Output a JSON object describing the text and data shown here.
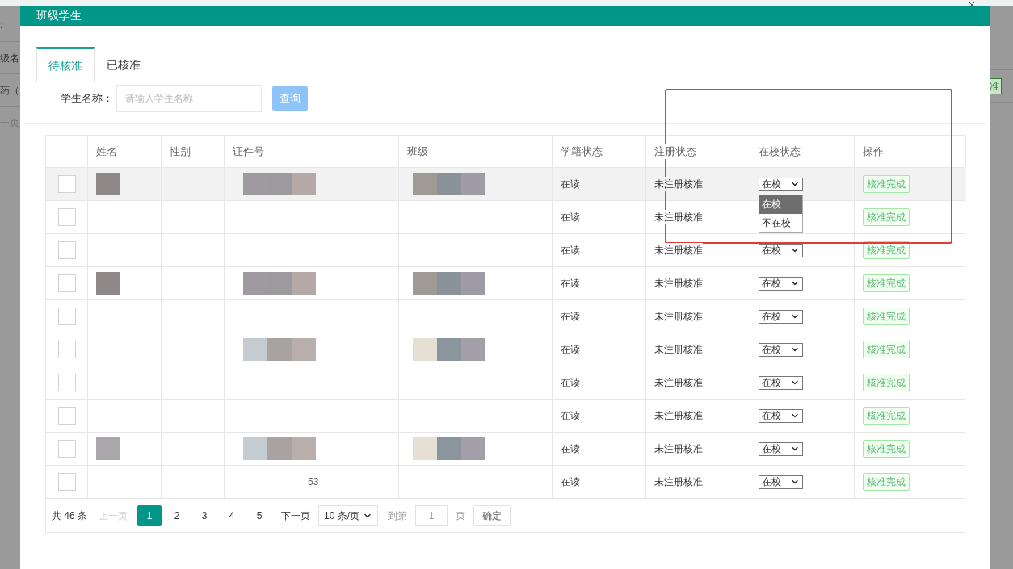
{
  "background": {
    "left_texts": [
      ":",
      "级名",
      "药（",
      "一页"
    ],
    "right_button": "准"
  },
  "dialog": {
    "title": "班级学生",
    "tabs": [
      {
        "label": "待核准",
        "selected": true
      },
      {
        "label": "已核准",
        "selected": false
      }
    ],
    "search": {
      "label": "学生名称：",
      "placeholder": "请输入学生名称",
      "button": "查询"
    },
    "table": {
      "columns": [
        "姓名",
        "性别",
        "证件号",
        "班级",
        "学籍状态",
        "注册状态",
        "在校状态",
        "操作"
      ],
      "rows": [
        {
          "checked": false,
          "hovered": true,
          "name_masked": true,
          "id_masked": true,
          "class_masked": true,
          "enrollment": "在读",
          "registration": "未注册核准",
          "school_status": {
            "value": "在校",
            "open": true,
            "options": [
              {
                "label": "在校",
                "selected": true
              },
              {
                "label": "不在校",
                "selected": false
              }
            ]
          },
          "action": "核准完成"
        },
        {
          "checked": false,
          "hovered": false,
          "name_masked": false,
          "id_masked": false,
          "class_masked": false,
          "enrollment": "在读",
          "registration": "未注册核准",
          "action": "核准完成"
        },
        {
          "checked": false,
          "hovered": false,
          "name_masked": false,
          "id_masked": false,
          "class_masked": false,
          "enrollment": "在读",
          "registration": "未注册核准",
          "school_status": {
            "value": "在校"
          },
          "action": "核准完成"
        },
        {
          "checked": false,
          "hovered": false,
          "name_masked": true,
          "id_masked": true,
          "class_masked": true,
          "enrollment": "在读",
          "registration": "未注册核准",
          "school_status": {
            "value": "在校"
          },
          "action": "核准完成"
        },
        {
          "checked": false,
          "hovered": false,
          "name_masked": false,
          "id_masked": false,
          "class_masked": false,
          "enrollment": "在读",
          "registration": "未注册核准",
          "school_status": {
            "value": "在校"
          },
          "action": "核准完成"
        },
        {
          "checked": false,
          "hovered": false,
          "name_masked": false,
          "id_masked": true,
          "class_masked": true,
          "enrollment": "在读",
          "registration": "未注册核准",
          "school_status": {
            "value": "在校"
          },
          "action": "核准完成"
        },
        {
          "checked": false,
          "hovered": false,
          "name_masked": false,
          "id_masked": false,
          "class_masked": false,
          "enrollment": "在读",
          "registration": "未注册核准",
          "school_status": {
            "value": "在校"
          },
          "action": "核准完成"
        },
        {
          "checked": false,
          "hovered": false,
          "name_masked": false,
          "id_masked": false,
          "class_masked": false,
          "enrollment": "在读",
          "registration": "未注册核准",
          "school_status": {
            "value": "在校"
          },
          "action": "核准完成"
        },
        {
          "checked": false,
          "hovered": false,
          "name_masked": true,
          "id_masked": true,
          "class_masked": true,
          "enrollment": "在读",
          "registration": "未注册核准",
          "school_status": {
            "value": "在校"
          },
          "action": "核准完成"
        },
        {
          "checked": false,
          "hovered": false,
          "name_masked": false,
          "id_masked": false,
          "class_masked": false,
          "id_number": "53",
          "enrollment": "在读",
          "registration": "未注册核准",
          "school_status": {
            "value": "在校"
          },
          "action": "核准完成"
        }
      ]
    },
    "pagination": {
      "total": "共 46 条",
      "prev": "上一页",
      "pages": [
        {
          "label": "1",
          "selected": true
        },
        {
          "label": "2",
          "selected": false
        },
        {
          "label": "3",
          "selected": false
        },
        {
          "label": "4",
          "selected": false
        },
        {
          "label": "5",
          "selected": false
        }
      ],
      "next": "下一页",
      "page_size": "10 条/页",
      "goto_label": "到第",
      "goto_value": "1",
      "page_unit": "页",
      "confirm": "确定"
    }
  },
  "annotation": {
    "kind": "rectangle"
  }
}
